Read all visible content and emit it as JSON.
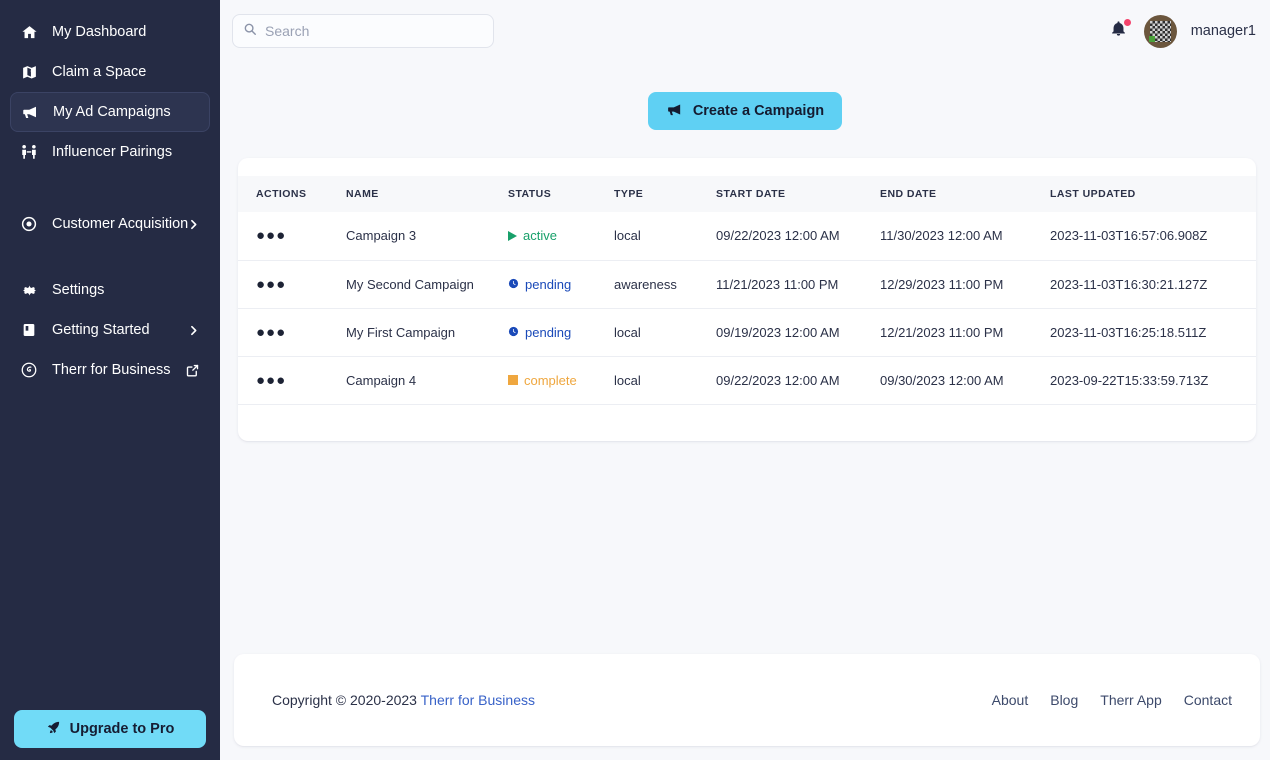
{
  "sidebar": {
    "items": [
      {
        "label": "My Dashboard",
        "icon": "home-icon",
        "active": false
      },
      {
        "label": "Claim a Space",
        "icon": "map-icon",
        "active": false
      },
      {
        "label": "My Ad Campaigns",
        "icon": "megaphone-icon",
        "active": true
      },
      {
        "label": "Influencer Pairings",
        "icon": "people-icon",
        "active": false
      },
      {
        "label": "Customer Acquisition",
        "icon": "target-icon",
        "active": false,
        "chevron": true
      },
      {
        "label": "Settings",
        "icon": "gear-icon",
        "active": false
      },
      {
        "label": "Getting Started",
        "icon": "book-icon",
        "active": false,
        "chevron": true
      },
      {
        "label": "Therr for Business",
        "icon": "therr-logo-icon",
        "active": false,
        "external": true
      }
    ],
    "upgrade_label": "Upgrade to Pro",
    "upgrade_icon": "rocket-icon",
    "accent_color": "#71dbf7",
    "background_color": "#252b44"
  },
  "topbar": {
    "search_placeholder": "Search",
    "search_value": "",
    "search_icon": "search-icon",
    "bell_icon": "bell-icon",
    "has_notification": true,
    "username": "manager1"
  },
  "main": {
    "create_button_label": "Create a Campaign",
    "create_button_icon": "megaphone-icon",
    "create_button_color": "#5fd0f3"
  },
  "table": {
    "columns": [
      "Actions",
      "Name",
      "Status",
      "Type",
      "Start Date",
      "End Date",
      "Last Updated"
    ],
    "row_action_icon": "ellipsis-icon",
    "rows": [
      {
        "name": "Campaign 3",
        "status": "active",
        "status_color": "#18a06a",
        "status_icon": "play-triangle-icon",
        "type": "local",
        "start_date": "09/22/2023 12:00 AM",
        "end_date": "11/30/2023 12:00 AM",
        "last_updated": "2023-11-03T16:57:06.908Z"
      },
      {
        "name": "My Second Campaign",
        "status": "pending",
        "status_color": "#1a49b8",
        "status_icon": "clock-icon",
        "type": "awareness",
        "start_date": "11/21/2023 11:00 PM",
        "end_date": "12/29/2023 11:00 PM",
        "last_updated": "2023-11-03T16:30:21.127Z"
      },
      {
        "name": "My First Campaign",
        "status": "pending",
        "status_color": "#1a49b8",
        "status_icon": "clock-icon",
        "type": "local",
        "start_date": "09/19/2023 12:00 AM",
        "end_date": "12/21/2023 11:00 PM",
        "last_updated": "2023-11-03T16:25:18.511Z"
      },
      {
        "name": "Campaign 4",
        "status": "complete",
        "status_color": "#efa73f",
        "status_icon": "square-icon",
        "type": "local",
        "start_date": "09/22/2023 12:00 AM",
        "end_date": "09/30/2023 12:00 AM",
        "last_updated": "2023-09-22T15:33:59.713Z"
      }
    ]
  },
  "footer": {
    "copyright_text": "Copyright © 2020-2023 ",
    "copyright_link": "Therr for Business",
    "links": [
      "About",
      "Blog",
      "Therr App",
      "Contact"
    ]
  }
}
